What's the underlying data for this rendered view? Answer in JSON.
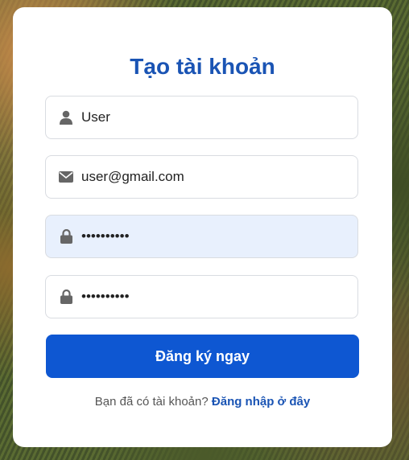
{
  "form": {
    "title": "Tạo tài khoản",
    "username": {
      "value": "User",
      "icon": "user-icon"
    },
    "email": {
      "value": "user@gmail.com",
      "icon": "envelope-icon"
    },
    "password": {
      "value": "••••••••••",
      "icon": "lock-icon"
    },
    "confirm_password": {
      "value": "••••••••••",
      "icon": "lock-icon"
    },
    "submit_label": "Đăng ký ngay",
    "footer_text": "Bạn đã có tài khoản?",
    "login_link_label": "Đăng nhập ở đây"
  },
  "colors": {
    "accent": "#0e57d2",
    "title": "#1a54b4",
    "autofill_bg": "#e8f0fd"
  }
}
